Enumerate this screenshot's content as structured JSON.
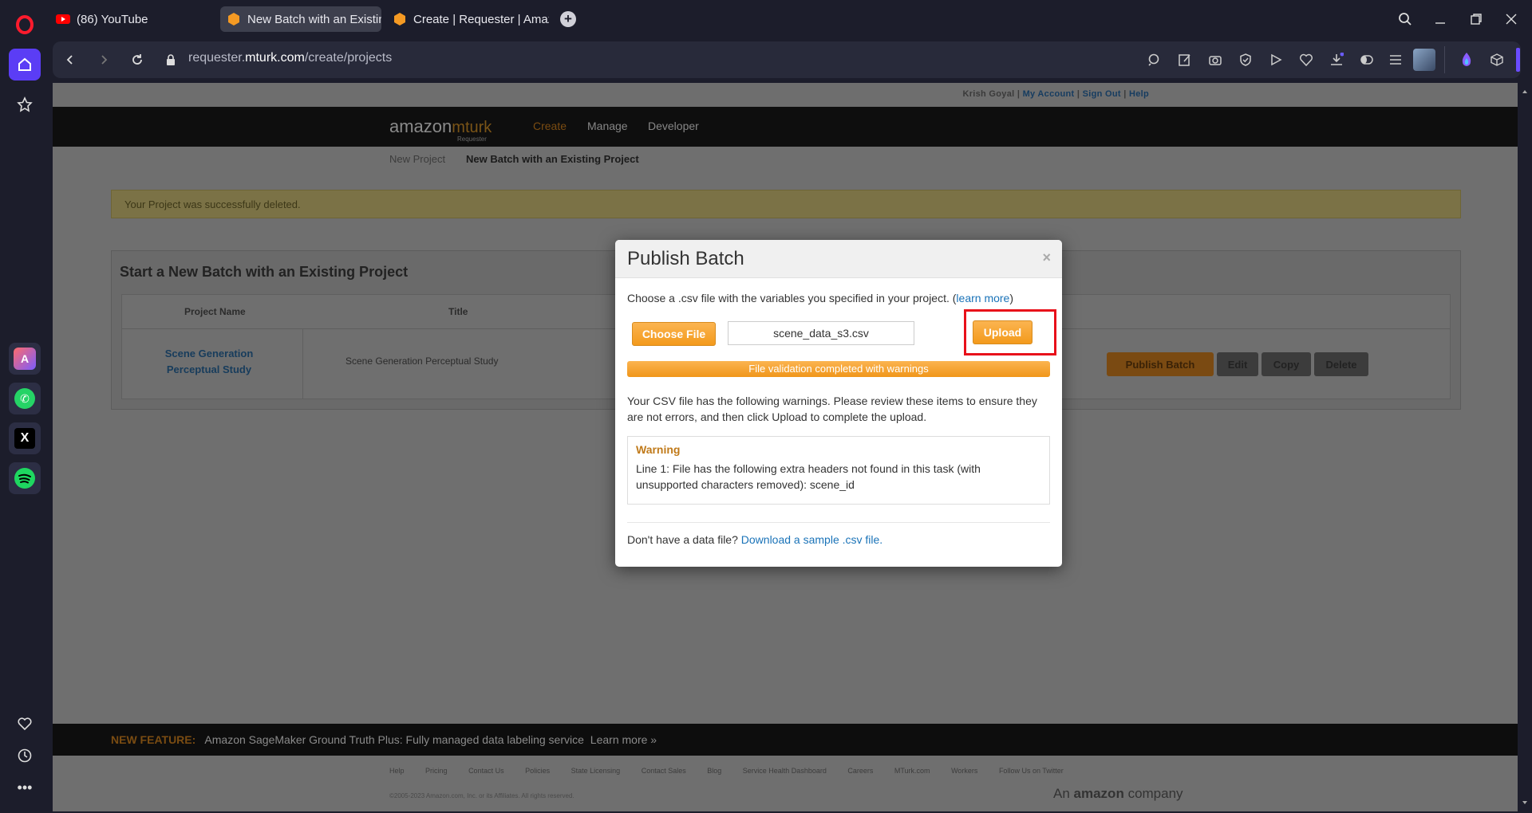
{
  "browser": {
    "tabs": [
      {
        "label": "(86) YouTube",
        "active": false
      },
      {
        "label": "New Batch with an Existing",
        "active": true
      },
      {
        "label": "Create | Requester | Amazo",
        "active": false
      }
    ],
    "url_prefix": "requester.",
    "url_domain": "mturk.com",
    "url_path": "/create/projects"
  },
  "page": {
    "user_name": "Krish Goyal",
    "user_links": [
      "My Account",
      "Sign Out",
      "Help"
    ],
    "logo_amazon": "amazon",
    "logo_mturk": "mturk",
    "logo_sub": "Requester",
    "nav": [
      "Create",
      "Manage",
      "Developer"
    ],
    "breadcrumb": [
      "New Project",
      "New Batch with an Existing Project"
    ],
    "alert": "Your Project was successfully deleted.",
    "panel_title": "Start a New Batch with an Existing Project",
    "columns": [
      "Project Name",
      "Title"
    ],
    "project_name": "Scene Generation Perceptual Study",
    "project_title": "Scene Generation Perceptual Study",
    "actions": [
      "Publish Batch",
      "Edit",
      "Copy",
      "Delete"
    ],
    "banner_label": "NEW FEATURE:",
    "banner_text": "Amazon SageMaker Ground Truth Plus: Fully managed data labeling service",
    "banner_link": "Learn more »",
    "footer_links": [
      "Help",
      "Pricing",
      "Contact Us",
      "Policies",
      "State Licensing",
      "Contact Sales",
      "Blog",
      "Service Health Dashboard",
      "Careers",
      "MTurk.com",
      "Workers",
      "Follow Us on Twitter"
    ],
    "copyright": "©2005-2023 Amazon.com, Inc. or its Affiliates. All rights reserved.",
    "amazon_company_prefix": "An",
    "amazon_company_brand": "amazon",
    "amazon_company_suffix": "company"
  },
  "modal": {
    "title": "Publish Batch",
    "close": "×",
    "instruction": "Choose a .csv file with the variables you specified in your project. (",
    "learn_more": "learn more",
    "instruction_end": ")",
    "choose_file": "Choose File",
    "file_name": "scene_data_s3.csv",
    "upload": "Upload",
    "progress_text": "File validation completed with warnings",
    "warnings_intro": "Your CSV file has the following warnings. Please review these items to ensure they are not errors, and then click Upload to complete the upload.",
    "warning_title": "Warning",
    "warning_line": "Line 1: File has the following extra headers not found in this task (with unsupported characters removed): scene_id",
    "no_data_file": "Don't have a data file?",
    "download_sample": "Download a sample .csv file."
  }
}
